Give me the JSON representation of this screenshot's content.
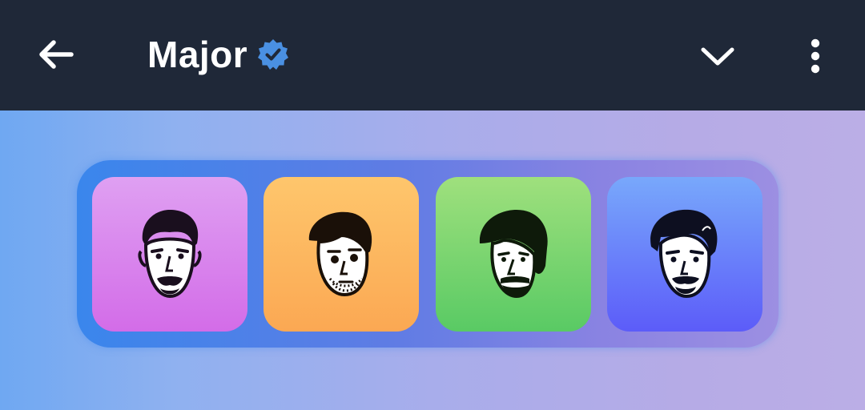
{
  "header": {
    "title": "Major",
    "icons": [
      "back-arrow-icon",
      "verified-badge-icon",
      "chevron-down-icon",
      "more-vertical-icon"
    ]
  },
  "avatars": [
    {
      "icon": "avatar-face-1-icon",
      "color_top": "#dfa0f2",
      "color_bottom": "#d36ce8"
    },
    {
      "icon": "avatar-face-2-icon",
      "color_top": "#fec66c",
      "color_bottom": "#fba853"
    },
    {
      "icon": "avatar-face-3-icon",
      "color_top": "#9fe07d",
      "color_bottom": "#59ca64"
    },
    {
      "icon": "avatar-face-4-icon",
      "color_top": "#78a8fb",
      "color_bottom": "#5c5cf9"
    }
  ],
  "colors": {
    "header_bg": "#1f2838",
    "verified_badge": "#4a90e2",
    "tray_start": "#3a86ec",
    "tray_end": "#9c8fe2"
  }
}
